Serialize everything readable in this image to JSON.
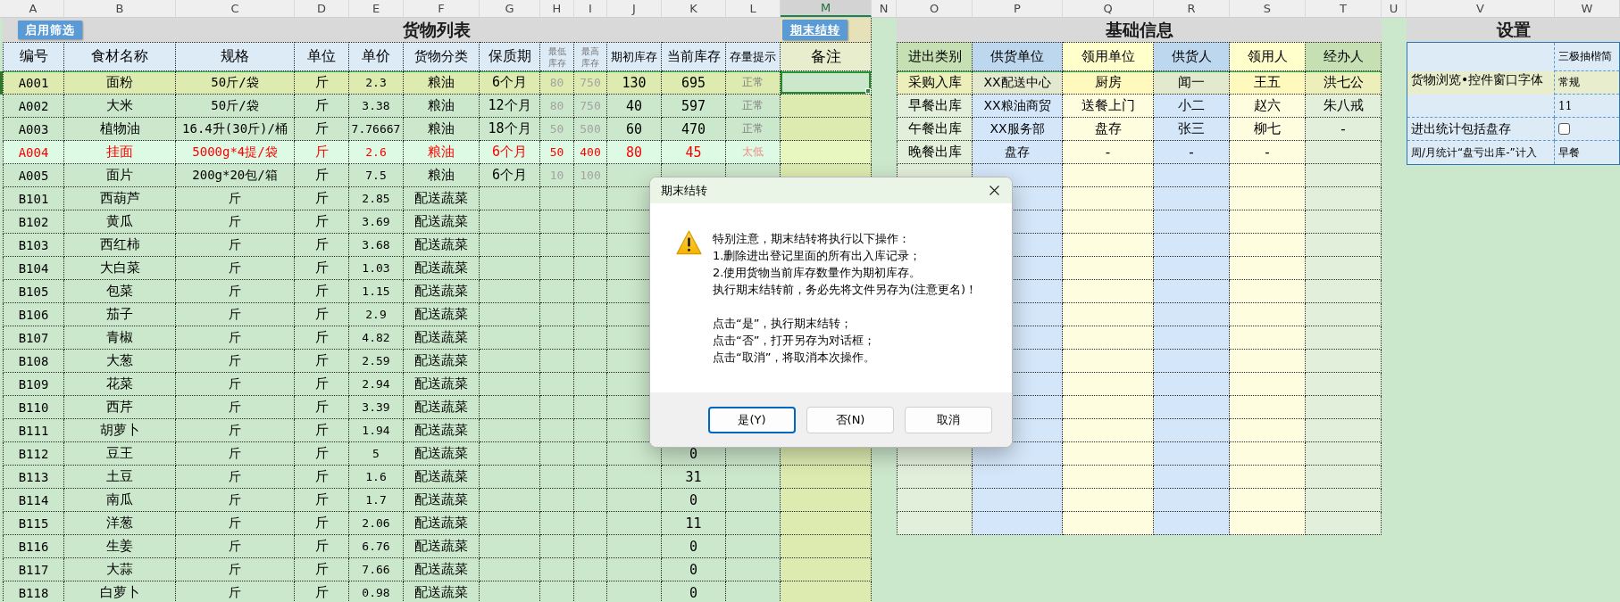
{
  "column_letters": [
    {
      "label": "A",
      "selected": false
    },
    {
      "label": "B",
      "selected": false
    },
    {
      "label": "C",
      "selected": false
    },
    {
      "label": "D",
      "selected": false
    },
    {
      "label": "E",
      "selected": false
    },
    {
      "label": "F",
      "selected": false
    },
    {
      "label": "G",
      "selected": false
    },
    {
      "label": "H",
      "selected": false
    },
    {
      "label": "I",
      "selected": false
    },
    {
      "label": "J",
      "selected": false
    },
    {
      "label": "K",
      "selected": false
    },
    {
      "label": "L",
      "selected": false
    },
    {
      "label": "M",
      "selected": true
    },
    {
      "label": "N",
      "selected": false
    },
    {
      "label": "O",
      "selected": false
    },
    {
      "label": "P",
      "selected": false
    },
    {
      "label": "Q",
      "selected": false
    },
    {
      "label": "R",
      "selected": false
    },
    {
      "label": "S",
      "selected": false
    },
    {
      "label": "T",
      "selected": false
    },
    {
      "label": "U",
      "selected": false
    },
    {
      "label": "V",
      "selected": false
    },
    {
      "label": "W",
      "selected": false
    }
  ],
  "goods": {
    "title": "货物列表",
    "filter_button": "启用筛选",
    "carryover_button": "期末结转",
    "columns": [
      "编号",
      "食材名称",
      "规格",
      "单位",
      "单价",
      "货物分类",
      "保质期",
      "最低库存",
      "最高库存",
      "期初库存",
      "当前库存",
      "存量提示",
      "备注"
    ],
    "rows": [
      {
        "code": "A001",
        "name": "面粉",
        "spec": "50斤/袋",
        "unit": "斤",
        "price": "2.3",
        "category": "粮油",
        "shelf_life": "6个月",
        "min_stock": "80",
        "max_stock": "750",
        "opening_stock": "130",
        "current_stock": "695",
        "stock_hint": "正常",
        "selected": true,
        "low_stock": false
      },
      {
        "code": "A002",
        "name": "大米",
        "spec": "50斤/袋",
        "unit": "斤",
        "price": "3.38",
        "category": "粮油",
        "shelf_life": "12个月",
        "min_stock": "80",
        "max_stock": "750",
        "opening_stock": "40",
        "current_stock": "597",
        "stock_hint": "正常",
        "selected": false,
        "low_stock": false
      },
      {
        "code": "A003",
        "name": "植物油",
        "spec": "16.4升(30斤)/桶",
        "unit": "斤",
        "price": "7.76667",
        "category": "粮油",
        "shelf_life": "18个月",
        "min_stock": "50",
        "max_stock": "500",
        "opening_stock": "60",
        "current_stock": "470",
        "stock_hint": "正常",
        "selected": false,
        "low_stock": false
      },
      {
        "code": "A004",
        "name": "挂面",
        "spec": "5000g*4提/袋",
        "unit": "斤",
        "price": "2.6",
        "category": "粮油",
        "shelf_life": "6个月",
        "min_stock": "50",
        "max_stock": "400",
        "opening_stock": "80",
        "current_stock": "45",
        "stock_hint": "太低",
        "selected": false,
        "low_stock": true
      },
      {
        "code": "A005",
        "name": "面片",
        "spec": "200g*20包/箱",
        "unit": "斤",
        "price": "7.5",
        "category": "粮油",
        "shelf_life": "6个月",
        "min_stock": "10",
        "max_stock": "100",
        "selected": false,
        "low_stock": false
      },
      {
        "code": "B101",
        "name": "西葫芦",
        "spec": "斤",
        "unit": "斤",
        "price": "2.85",
        "category": "配送蔬菜",
        "selected": false,
        "low_stock": false
      },
      {
        "code": "B102",
        "name": "黄瓜",
        "spec": "斤",
        "unit": "斤",
        "price": "3.69",
        "category": "配送蔬菜",
        "selected": false,
        "low_stock": false
      },
      {
        "code": "B103",
        "name": "西红柿",
        "spec": "斤",
        "unit": "斤",
        "price": "3.68",
        "category": "配送蔬菜",
        "selected": false,
        "low_stock": false
      },
      {
        "code": "B104",
        "name": "大白菜",
        "spec": "斤",
        "unit": "斤",
        "price": "1.03",
        "category": "配送蔬菜",
        "selected": false,
        "low_stock": false
      },
      {
        "code": "B105",
        "name": "包菜",
        "spec": "斤",
        "unit": "斤",
        "price": "1.15",
        "category": "配送蔬菜",
        "selected": false,
        "low_stock": false
      },
      {
        "code": "B106",
        "name": "茄子",
        "spec": "斤",
        "unit": "斤",
        "price": "2.9",
        "category": "配送蔬菜",
        "selected": false,
        "low_stock": false
      },
      {
        "code": "B107",
        "name": "青椒",
        "spec": "斤",
        "unit": "斤",
        "price": "4.82",
        "category": "配送蔬菜",
        "selected": false,
        "low_stock": false
      },
      {
        "code": "B108",
        "name": "大葱",
        "spec": "斤",
        "unit": "斤",
        "price": "2.59",
        "category": "配送蔬菜",
        "selected": false,
        "low_stock": false
      },
      {
        "code": "B109",
        "name": "花菜",
        "spec": "斤",
        "unit": "斤",
        "price": "2.94",
        "category": "配送蔬菜",
        "selected": false,
        "low_stock": false
      },
      {
        "code": "B110",
        "name": "西芹",
        "spec": "斤",
        "unit": "斤",
        "price": "3.39",
        "category": "配送蔬菜",
        "selected": false,
        "low_stock": false
      },
      {
        "code": "B111",
        "name": "胡萝卜",
        "spec": "斤",
        "unit": "斤",
        "price": "1.94",
        "category": "配送蔬菜",
        "selected": false,
        "low_stock": false
      },
      {
        "code": "B112",
        "name": "豆王",
        "spec": "斤",
        "unit": "斤",
        "price": "5",
        "category": "配送蔬菜",
        "current_stock": "0",
        "selected": false,
        "low_stock": false
      },
      {
        "code": "B113",
        "name": "土豆",
        "spec": "斤",
        "unit": "斤",
        "price": "1.6",
        "category": "配送蔬菜",
        "current_stock": "31",
        "selected": false,
        "low_stock": false
      },
      {
        "code": "B114",
        "name": "南瓜",
        "spec": "斤",
        "unit": "斤",
        "price": "1.7",
        "category": "配送蔬菜",
        "current_stock": "0",
        "selected": false,
        "low_stock": false
      },
      {
        "code": "B115",
        "name": "洋葱",
        "spec": "斤",
        "unit": "斤",
        "price": "2.06",
        "category": "配送蔬菜",
        "current_stock": "11",
        "selected": false,
        "low_stock": false
      },
      {
        "code": "B116",
        "name": "生姜",
        "spec": "斤",
        "unit": "斤",
        "price": "6.76",
        "category": "配送蔬菜",
        "current_stock": "0",
        "selected": false,
        "low_stock": false
      },
      {
        "code": "B117",
        "name": "大蒜",
        "spec": "斤",
        "unit": "斤",
        "price": "7.66",
        "category": "配送蔬菜",
        "current_stock": "0",
        "selected": false,
        "low_stock": false
      },
      {
        "code": "B118",
        "name": "白萝卜",
        "spec": "斤",
        "unit": "斤",
        "price": "0.98",
        "category": "配送蔬菜",
        "current_stock": "0",
        "selected": false,
        "low_stock": false
      }
    ]
  },
  "basic_info": {
    "title": "基础信息",
    "columns": [
      "进出类别",
      "供货单位",
      "领用单位",
      "供货人",
      "领用人",
      "经办人"
    ],
    "rows": [
      [
        "采购入库",
        "XX配送中心",
        "厨房",
        "闻一",
        "王五",
        "洪七公"
      ],
      [
        "早餐出库",
        "XX粮油商贸",
        "送餐上门",
        "小二",
        "赵六",
        "朱八戒"
      ],
      [
        "午餐出库",
        "XX服务部",
        "盘存",
        "张三",
        "柳七",
        "-"
      ],
      [
        "晚餐出库",
        "盘存",
        "-",
        "-",
        "-"
      ]
    ]
  },
  "settings": {
    "title": "设置",
    "items": [
      {
        "kind": "value",
        "label": "货物浏览•控件窗口字体",
        "values": [
          "三极抽楷简",
          "常规",
          "11"
        ]
      },
      {
        "kind": "checkbox",
        "label": "进出统计包括盘存",
        "checked": false
      },
      {
        "kind": "value",
        "label": "周/月统计“盘亏出库-”计入",
        "values": [
          "早餐"
        ]
      }
    ]
  },
  "dialog": {
    "title": "期末结转",
    "message": [
      "特别注意，期末结转将执行以下操作：",
      "1.删除进出登记里面的所有出入库记录；",
      "2.使用货物当前库存数量作为期初库存。",
      "执行期末结转前，务必先将文件另存为(注意更名)！"
    ],
    "instructions": [
      "点击“是”，执行期末结转；",
      "点击“否”，打开另存为对话框；",
      "点击“取消”，将取消本次操作。"
    ],
    "buttons": [
      {
        "label": "是(Y)",
        "selected": true
      },
      {
        "label": "否(N)",
        "selected": false
      },
      {
        "label": "取消",
        "selected": false
      }
    ]
  }
}
